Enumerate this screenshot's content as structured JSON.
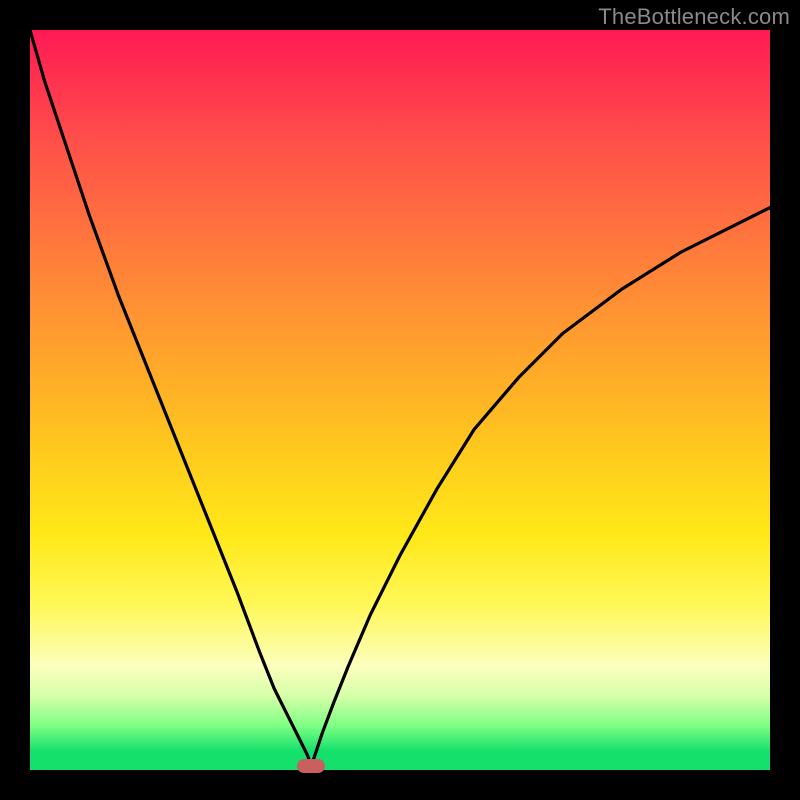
{
  "watermark": "TheBottleneck.com",
  "chart_data": {
    "type": "line",
    "title": "",
    "xlabel": "",
    "ylabel": "",
    "xlim": [
      0,
      100
    ],
    "ylim": [
      0,
      100
    ],
    "x": [
      0,
      2,
      5,
      8,
      12,
      16,
      20,
      24,
      28,
      31,
      33,
      35,
      36.5,
      37.5,
      38,
      38.5,
      39.5,
      41,
      43,
      46,
      50,
      55,
      60,
      66,
      72,
      80,
      88,
      100
    ],
    "values": [
      100,
      93,
      84,
      75,
      64,
      54,
      44,
      34,
      24,
      16,
      11,
      7,
      4,
      2,
      0.5,
      2,
      5,
      9,
      14,
      21,
      29,
      38,
      46,
      53,
      59,
      65,
      70,
      76
    ],
    "marker": {
      "x": 38,
      "y": 0.5
    },
    "notes": "Bottleneck-style curve plotted over a red→yellow→green vertical gradient. Values read as percentage height from the bottom of the plot area; the minimum near x≈38 touches the green band. No axis ticks or labels are shown."
  },
  "colors": {
    "background": "#000000",
    "gradient_top": "#ff1a53",
    "gradient_mid": "#ffe818",
    "gradient_bottom": "#14e06b",
    "curve": "#000000",
    "marker": "#c96060",
    "watermark": "#8a8a8a"
  }
}
